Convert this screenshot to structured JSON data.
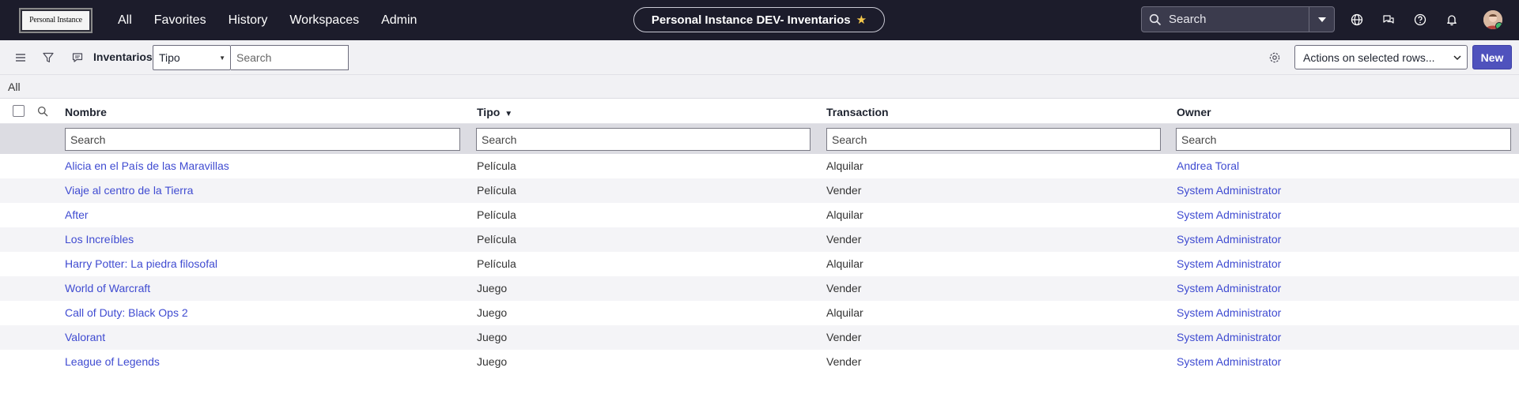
{
  "nav": {
    "logo_text": "Personal Instance",
    "menu": [
      "All",
      "Favorites",
      "History",
      "Workspaces",
      "Admin"
    ],
    "instance_title": "Personal Instance DEV- Inventarios",
    "search_placeholder": "Search",
    "icons": [
      "globe-icon",
      "chat-icon",
      "help-icon",
      "bell-icon"
    ]
  },
  "toolbar": {
    "list_title": "Inventarios",
    "field_select_value": "Tipo",
    "search_placeholder": "Search",
    "actions_label": "Actions on selected rows...",
    "new_label": "New"
  },
  "breadcrumb": "All",
  "table": {
    "columns": [
      {
        "label": "Nombre",
        "search_placeholder": "Search"
      },
      {
        "label": "Tipo",
        "search_placeholder": "Search",
        "sorted": "desc"
      },
      {
        "label": "Transaction",
        "search_placeholder": "Search"
      },
      {
        "label": "Owner",
        "search_placeholder": "Search"
      }
    ],
    "rows": [
      {
        "nombre": "Alicia en el País de las Maravillas",
        "tipo": "Película",
        "transaction": "Alquilar",
        "owner": "Andrea Toral"
      },
      {
        "nombre": "Viaje al centro de la Tierra",
        "tipo": "Película",
        "transaction": "Vender",
        "owner": "System Administrator"
      },
      {
        "nombre": "After",
        "tipo": "Película",
        "transaction": "Alquilar",
        "owner": "System Administrator"
      },
      {
        "nombre": "Los Increíbles",
        "tipo": "Película",
        "transaction": "Vender",
        "owner": "System Administrator"
      },
      {
        "nombre": "Harry Potter: La piedra filosofal",
        "tipo": "Película",
        "transaction": "Alquilar",
        "owner": "System Administrator"
      },
      {
        "nombre": "World of Warcraft",
        "tipo": "Juego",
        "transaction": "Vender",
        "owner": "System Administrator"
      },
      {
        "nombre": "Call of Duty: Black Ops 2",
        "tipo": "Juego",
        "transaction": "Alquilar",
        "owner": "System Administrator"
      },
      {
        "nombre": "Valorant",
        "tipo": "Juego",
        "transaction": "Vender",
        "owner": "System Administrator"
      },
      {
        "nombre": "League of Legends",
        "tipo": "Juego",
        "transaction": "Vender",
        "owner": "System Administrator"
      }
    ]
  },
  "colors": {
    "nav_bg": "#1c1c2b",
    "link": "#3f4bd1",
    "primary_button": "#4f52bd",
    "favorite_star": "#f5c84c"
  }
}
